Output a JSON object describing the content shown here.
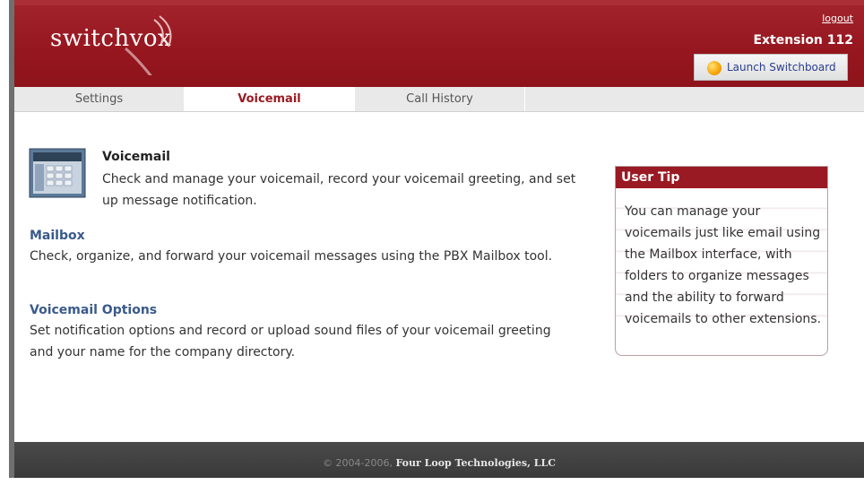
{
  "header": {
    "logo_text": "switchvox",
    "logout_label": "logout",
    "extension_label": "Extension 112",
    "launch_button_label": "Launch Switchboard"
  },
  "tabs": [
    {
      "label": "Settings",
      "active": false
    },
    {
      "label": "Voicemail",
      "active": true
    },
    {
      "label": "Call History",
      "active": false
    }
  ],
  "main": {
    "title": "Voicemail",
    "description": "Check and manage your voicemail, record your voicemail greeting, and set up message notification.",
    "sections": [
      {
        "title": "Mailbox",
        "description": "Check, organize, and forward your voicemail messages using the PBX Mailbox tool."
      },
      {
        "title": "Voicemail Options",
        "description": "Set notification options and record or upload sound files of your voicemail greeting and your name for the company directory."
      }
    ]
  },
  "tip": {
    "title": "User Tip",
    "body": "You can manage your voicemails just like email using the Mailbox interface, with folders to organize messages and the ability to forward voicemails to other extensions."
  },
  "footer": {
    "copyright": "© 2004-2006,",
    "company": "Four Loop Technologies, LLC"
  },
  "colors": {
    "brand_red": "#9a1a23",
    "link_blue": "#3a5a8c",
    "footer_bg": "#3f3f3f"
  }
}
